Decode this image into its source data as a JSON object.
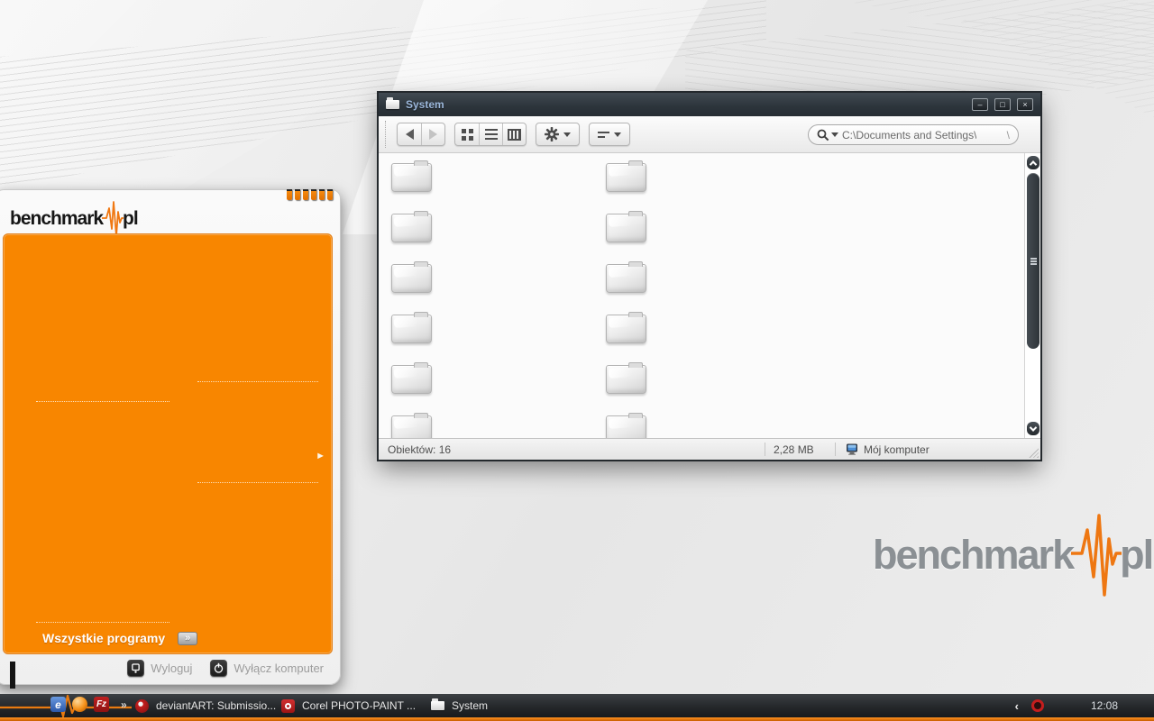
{
  "desktop": {
    "watermark": {
      "brand_left": "benchmark",
      "brand_right": "pl"
    }
  },
  "start_menu": {
    "logo_left": "benchmark",
    "logo_right": "pl",
    "all_programs_label": "Wszystkie programy",
    "all_programs_chevron": "»",
    "submenu_arrow": "►",
    "logoff_label": "Wyloguj",
    "shutdown_label": "Wyłącz komputer"
  },
  "window": {
    "title": "System",
    "controls": {
      "minimize": "–",
      "maximize": "□",
      "close": "×"
    },
    "toolbar": {
      "address_value": "C:\\Documents and Settings\\",
      "address_caret": "\\"
    },
    "content": {
      "grid": {
        "rows": 6,
        "columns": 2
      }
    },
    "status_bar": {
      "objects": "Obiektów: 16",
      "size": "2,28 MB",
      "location": "Mój komputer"
    }
  },
  "taskbar": {
    "quick_launch_overflow": "»",
    "tasks": [
      {
        "label": "deviantART: Submissio..."
      },
      {
        "label": "Corel PHOTO-PAINT ..."
      },
      {
        "label": "System"
      }
    ],
    "tray": {
      "collapse_chevron": "‹",
      "clock": "12:08"
    }
  }
}
